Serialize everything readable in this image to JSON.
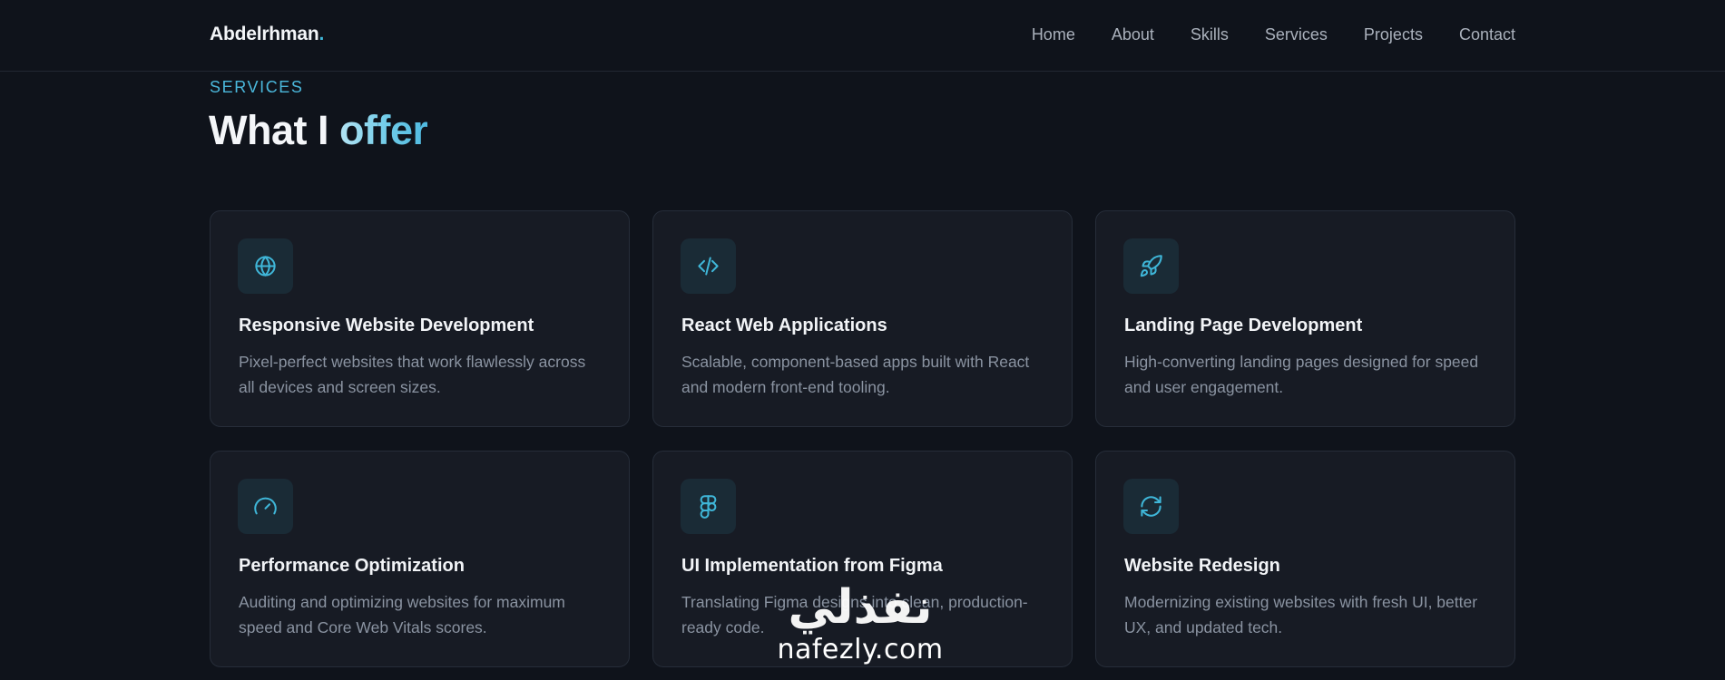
{
  "brand": {
    "name": "Abdelrhman",
    "dot": "."
  },
  "nav": {
    "links": [
      "Home",
      "About",
      "Skills",
      "Services",
      "Projects",
      "Contact"
    ]
  },
  "section": {
    "label": "SERVICES",
    "title_main": "What I ",
    "title_accent": "offer"
  },
  "services": [
    {
      "icon": "globe-icon",
      "title": "Responsive Website Development",
      "description": "Pixel-perfect websites that work flawlessly across all devices and screen sizes."
    },
    {
      "icon": "code-icon",
      "title": "React Web Applications",
      "description": "Scalable, component-based apps built with React and modern front-end tooling."
    },
    {
      "icon": "rocket-icon",
      "title": "Landing Page Development",
      "description": "High-converting landing pages designed for speed and user engagement."
    },
    {
      "icon": "gauge-icon",
      "title": "Performance Optimization",
      "description": "Auditing and optimizing websites for maximum speed and Core Web Vitals scores."
    },
    {
      "icon": "figma-icon",
      "title": "UI Implementation from Figma",
      "description": "Translating Figma designs into clean, production-ready code."
    },
    {
      "icon": "refresh-icon",
      "title": "Website Redesign",
      "description": "Modernizing existing websites with fresh UI, better UX, and updated tech."
    }
  ],
  "watermark": {
    "arabic": "نفذلي",
    "latin": "nafezly.com"
  },
  "colors": {
    "background": "#0f131b",
    "card": "#171b24",
    "accent": "#3fb6d8",
    "icon_box": "#1a2b36"
  }
}
